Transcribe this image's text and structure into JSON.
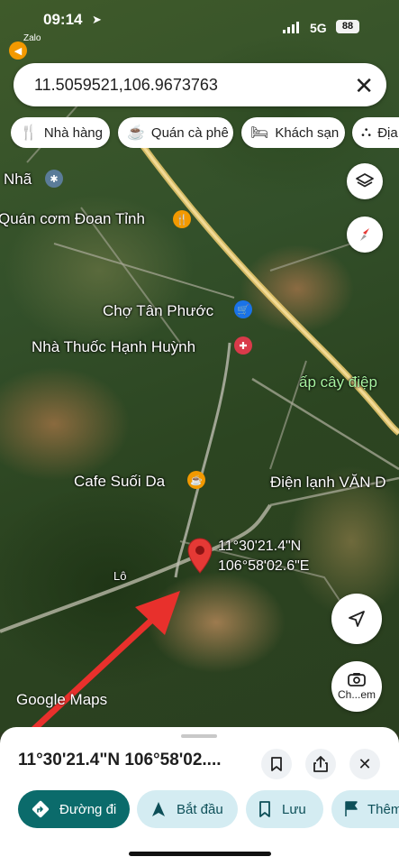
{
  "status_bar": {
    "time": "09:14",
    "back_app": "Zalo",
    "network": "5G",
    "battery": "88"
  },
  "search": {
    "query": "11.5059521,106.9673763"
  },
  "categories": [
    {
      "label": "Nhà hàng",
      "icon": "fork-knife-icon"
    },
    {
      "label": "Quán cà phê",
      "icon": "coffee-cup-icon"
    },
    {
      "label": "Khách sạn",
      "icon": "bed-icon"
    },
    {
      "label": "Địa",
      "icon": "attraction-icon"
    }
  ],
  "map": {
    "labels": {
      "nha": "Nhã",
      "quan_com": "Quán cơm Đoan Tỉnh",
      "cho": "Chợ Tân Phước",
      "nha_thuoc": "Nhà Thuốc Hạnh Huỳnh",
      "ap": "ấp cây điệp",
      "cafe": "Cafe Suối Da",
      "dien_lanh": "Điện lạnh VĂN D",
      "lo": "Lô"
    },
    "pin": {
      "lat": "11°30'21.4\"N",
      "lng": "106°58'02.6\"E"
    },
    "street_view_label": "Ch...em",
    "brand": "Google Maps",
    "colors": {
      "pin": "#e53935",
      "annotation_arrow": "#e8302c",
      "restaurant_poi": "#f29900",
      "shop_poi": "#1a73e8",
      "pharmacy_poi": "#d93a4a",
      "highway": "#f3d27a",
      "area_label": "#a7f3a0"
    }
  },
  "sheet": {
    "title": "11°30'21.4\"N 106°58'02....",
    "actions": [
      {
        "label": "Đường đi",
        "icon": "directions-icon"
      },
      {
        "label": "Bắt đầu",
        "icon": "navigation-arrow-icon"
      },
      {
        "label": "Lưu",
        "icon": "bookmark-icon"
      },
      {
        "label": "Thêm",
        "icon": "flag-icon"
      }
    ]
  }
}
